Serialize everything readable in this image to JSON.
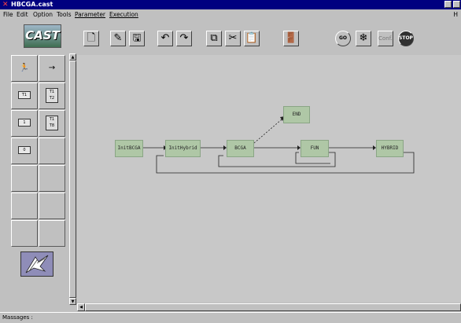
{
  "window": {
    "title": "HBCGA.cast"
  },
  "menu": {
    "items": [
      "File",
      "Edit",
      "Option",
      "Tools",
      "Parameter",
      "Execution"
    ],
    "help": "H"
  },
  "logo": {
    "text": "CAST"
  },
  "toolbar": {
    "conf_label": "Conf.",
    "stop_label": "STOP",
    "go_label": "GO"
  },
  "palette": {
    "items": [
      {
        "icon": "runner-icon",
        "glyph": "🏃"
      },
      {
        "icon": "arrow-right-icon",
        "glyph": "→"
      },
      {
        "icon": "task-t1-icon",
        "label": "T1"
      },
      {
        "icon": "task-t1-t2-icon",
        "label": "T1 T2"
      },
      {
        "icon": "task-1-icon",
        "label": "1"
      },
      {
        "icon": "task-t1-t8-icon",
        "label": "T1 T8"
      },
      {
        "icon": "task-0-icon",
        "label": "0"
      }
    ]
  },
  "diagram": {
    "nodes": [
      "InitBCGA",
      "InitHybrid",
      "BCGA",
      "END",
      "FUN",
      "HYBRID"
    ]
  },
  "status": {
    "label": "Massages :"
  }
}
